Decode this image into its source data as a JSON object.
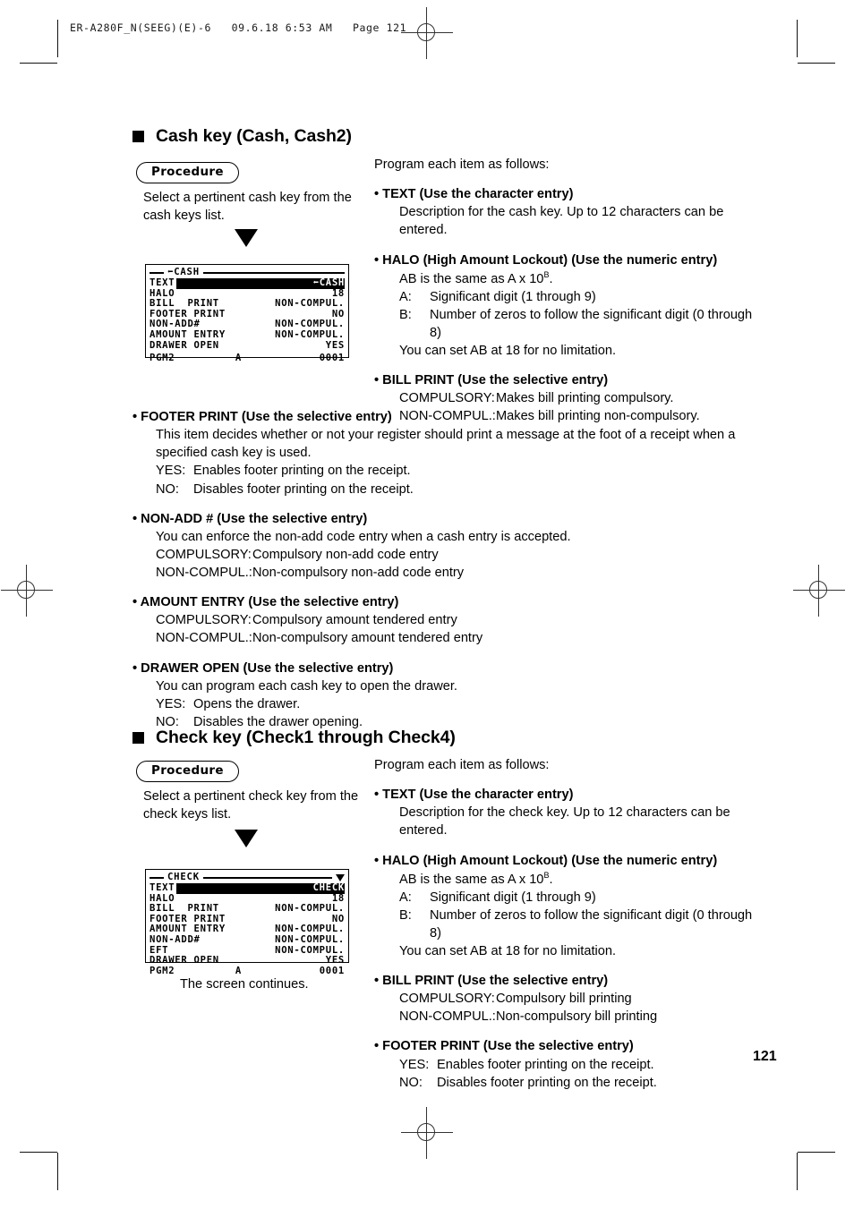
{
  "page": {
    "slug": "ER-A280F_N(SEEG)(E)-6   09.6.18 6:53 AM   Page 121",
    "number": "121"
  },
  "sections": [
    {
      "heading": "Cash key (Cash, Cash2)",
      "procedure_label": "Procedure",
      "procedure_text": "Select a pertinent cash key from the cash keys list.",
      "arrow": "down-triangle",
      "lcd": {
        "title": "CASH",
        "title_prefix_icon": "left-arrow-glyph",
        "rows": [
          {
            "label": "TEXT",
            "value": "CASH",
            "highlight": true
          },
          {
            "label": "HALO",
            "value": "18",
            "highlight": false
          },
          {
            "label": "BILL  PRINT",
            "value": "NON-COMPUL.",
            "highlight": false
          },
          {
            "label": "FOOTER PRINT",
            "value": "NO",
            "highlight": false
          },
          {
            "label": "NON-ADD#",
            "value": "NON-COMPUL.",
            "highlight": false
          },
          {
            "label": "AMOUNT ENTRY",
            "value": "NON-COMPUL.",
            "highlight": false
          },
          {
            "label": "DRAWER OPEN",
            "value": "YES",
            "highlight": false
          }
        ],
        "status": {
          "mode": "PGM2",
          "middle": "A",
          "counter": "0001"
        },
        "scroll_indicator": "none"
      },
      "lead": "Program each item as follows:",
      "right_items": [
        {
          "bullet": "• TEXT (Use the character entry)",
          "lines": [
            "Description for the cash key. Up to 12 characters can be",
            "entered."
          ]
        },
        {
          "bullet": "• HALO (High Amount Lockout) (Use the numeric entry)",
          "ab_prefix": "AB is the same as A x 10",
          "ab_sup": "B",
          "ab_suffix": ".",
          "defs": [
            {
              "k": "A:",
              "v": "Significant digit (1 through 9)"
            },
            {
              "k": "B:",
              "v": "Number of zeros to follow the significant digit (0 through"
            },
            {
              "k": "",
              "v": "8)"
            }
          ],
          "tail": "You can set AB at 18 for no limitation."
        },
        {
          "bullet": "• BILL PRINT (Use the selective entry)",
          "defs": [
            {
              "k": "COMPULSORY:",
              "v": "Makes bill printing compulsory."
            },
            {
              "k": "NON-COMPUL.:",
              "v": "Makes bill printing non-compulsory."
            }
          ]
        }
      ],
      "full_items": [
        {
          "bullet": "• FOOTER PRINT (Use the selective entry)",
          "lines": [
            "This item decides whether or not your register should print a message at the foot of a receipt when a",
            "specified cash key is used."
          ],
          "defs": [
            {
              "k": "YES:",
              "v": "Enables footer printing on the receipt."
            },
            {
              "k": "NO:",
              "v": "Disables footer printing on the receipt."
            }
          ]
        },
        {
          "bullet": "• NON-ADD # (Use the selective entry)",
          "lines": [
            "You can enforce the non-add code entry when a cash entry is accepted."
          ],
          "defs": [
            {
              "k": "COMPULSORY:",
              "v": "Compulsory non-add code entry"
            },
            {
              "k": "NON-COMPUL.:",
              "v": "Non-compulsory non-add code entry"
            }
          ]
        },
        {
          "bullet": "• AMOUNT ENTRY (Use the selective entry)",
          "lines": [],
          "defs": [
            {
              "k": "COMPULSORY:",
              "v": "Compulsory amount tendered entry"
            },
            {
              "k": "NON-COMPUL.:",
              "v": "Non-compulsory amount tendered entry"
            }
          ]
        },
        {
          "bullet": "• DRAWER OPEN (Use the selective entry)",
          "lines": [
            "You can program each cash key to open the drawer."
          ],
          "defs": [
            {
              "k": "YES:",
              "v": "Opens the drawer."
            },
            {
              "k": "NO:",
              "v": "Disables the drawer opening."
            }
          ]
        }
      ]
    },
    {
      "heading": "Check key (Check1 through Check4)",
      "procedure_label": "Procedure",
      "procedure_text": "Select a pertinent check key from the check keys list.",
      "arrow": "down-triangle",
      "lcd": {
        "title": "CHECK",
        "rows": [
          {
            "label": "TEXT",
            "value": "CHECK",
            "highlight": true
          },
          {
            "label": "HALO",
            "value": "18",
            "highlight": false
          },
          {
            "label": "BILL  PRINT",
            "value": "NON-COMPUL.",
            "highlight": false
          },
          {
            "label": "FOOTER PRINT",
            "value": "NO",
            "highlight": false
          },
          {
            "label": "AMOUNT ENTRY",
            "value": "NON-COMPUL.",
            "highlight": false
          },
          {
            "label": "NON-ADD#",
            "value": "NON-COMPUL.",
            "highlight": false
          },
          {
            "label": "EFT",
            "value": "NON-COMPUL.",
            "highlight": false
          },
          {
            "label": "DRAWER OPEN",
            "value": "YES",
            "highlight": false
          }
        ],
        "status": {
          "mode": "PGM2",
          "middle": "A",
          "counter": "0001"
        },
        "scroll_indicator": "down-triangle"
      },
      "screen_caption": "The screen continues.",
      "lead": "Program each item as follows:",
      "right_items": [
        {
          "bullet": "• TEXT (Use the character entry)",
          "lines": [
            "Description for the check key. Up to 12 characters can be",
            "entered."
          ]
        },
        {
          "bullet": "• HALO (High Amount Lockout) (Use the numeric entry)",
          "ab_prefix": "AB is the same as A x 10",
          "ab_sup": "B",
          "ab_suffix": ".",
          "defs": [
            {
              "k": "A:",
              "v": "Significant digit (1 through 9)"
            },
            {
              "k": "B:",
              "v": "Number of zeros to follow the significant digit (0 through"
            },
            {
              "k": "",
              "v": "8)"
            }
          ],
          "tail": "You can set AB at 18 for no limitation."
        },
        {
          "bullet": "• BILL PRINT (Use the selective entry)",
          "defs": [
            {
              "k": "COMPULSORY:",
              "v": "Compulsory bill printing"
            },
            {
              "k": "NON-COMPUL.:",
              "v": "Non-compulsory bill printing"
            }
          ]
        },
        {
          "bullet": "• FOOTER PRINT (Use the selective entry)",
          "defs": [
            {
              "k": "YES:",
              "v": "Enables footer printing on the receipt."
            },
            {
              "k": "NO:",
              "v": "Disables footer printing on the receipt."
            }
          ]
        }
      ]
    }
  ]
}
